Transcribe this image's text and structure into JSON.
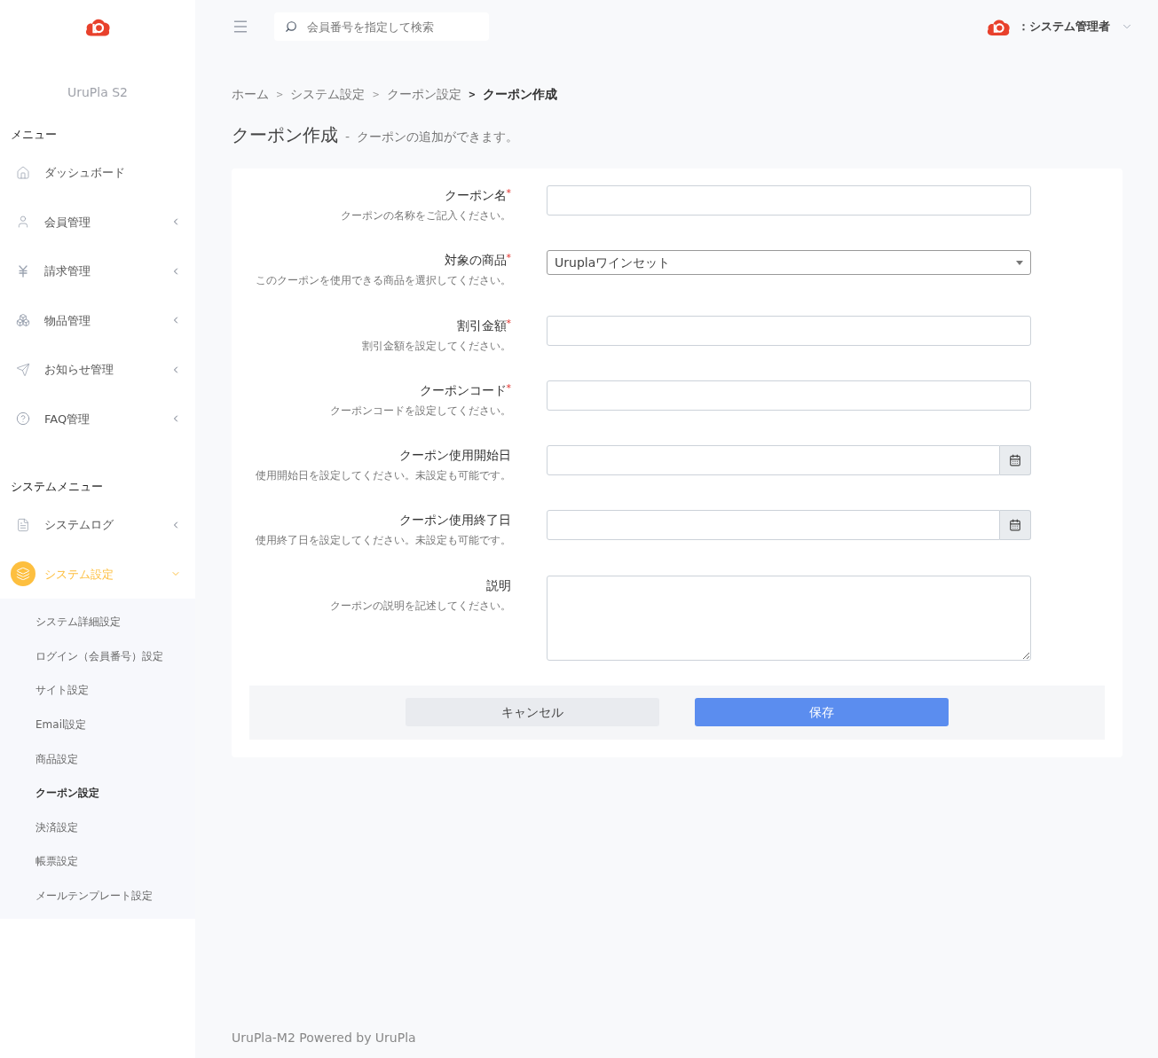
{
  "sidebar": {
    "brand": "UruPla S2",
    "sections": [
      {
        "title": "メニュー",
        "items": [
          {
            "label": "ダッシュボード",
            "expandable": false,
            "selected": false
          },
          {
            "label": "会員管理",
            "expandable": true,
            "selected": false,
            "expanded": false
          },
          {
            "label": "請求管理",
            "expandable": true,
            "selected": false,
            "expanded": false
          },
          {
            "label": "物品管理",
            "expandable": true,
            "selected": false,
            "expanded": false
          },
          {
            "label": "お知らせ管理",
            "expandable": true,
            "selected": false,
            "expanded": false
          },
          {
            "label": "FAQ管理",
            "expandable": true,
            "selected": false,
            "expanded": false
          }
        ]
      },
      {
        "title": "システムメニュー",
        "items": [
          {
            "label": "システムログ",
            "expandable": true,
            "selected": false,
            "expanded": false
          },
          {
            "label": "システム設定",
            "expandable": true,
            "selected": true,
            "expanded": true,
            "children": [
              {
                "label": "システム詳細設定",
                "selected": false
              },
              {
                "label": "ログイン（会員番号）設定",
                "selected": false
              },
              {
                "label": "サイト設定",
                "selected": false
              },
              {
                "label": "Email設定",
                "selected": false
              },
              {
                "label": "商品設定",
                "selected": false
              },
              {
                "label": "クーポン設定",
                "selected": true
              },
              {
                "label": "決済設定",
                "selected": false
              },
              {
                "label": "帳票設定",
                "selected": false
              },
              {
                "label": "メールテンプレート設定",
                "selected": false
              }
            ]
          }
        ]
      }
    ]
  },
  "header": {
    "search": {
      "placeholder": "会員番号を指定して検索"
    },
    "user": "：システム管理者"
  },
  "breadcrumb": [
    {
      "label": "ホーム",
      "current": false
    },
    {
      "label": "システム設定",
      "current": false
    },
    {
      "label": "クーポン設定",
      "current": false
    },
    {
      "label": "クーポン作成",
      "current": true
    }
  ],
  "breadcrumb_separator": ">",
  "page": {
    "title": "クーポン作成",
    "separator": "-",
    "subtitle": "クーポンの追加ができます。"
  },
  "form": {
    "fields": [
      {
        "kind": "text",
        "label": "クーポン名",
        "required": true,
        "help": "クーポンの名称をご記入ください。"
      },
      {
        "kind": "select",
        "label": "対象の商品",
        "required": true,
        "help": "このクーポンを使用できる商品を選択してください。",
        "value": "Uruplaワインセット"
      },
      {
        "kind": "text",
        "label": "割引金額",
        "required": true,
        "help": "割引金額を設定してください。"
      },
      {
        "kind": "text",
        "label": "クーポンコード",
        "required": true,
        "help": "クーポンコードを設定してください。"
      },
      {
        "kind": "date",
        "label": "クーポン使用開始日",
        "required": false,
        "help": "使用開始日を設定してください。未設定も可能です。"
      },
      {
        "kind": "date",
        "label": "クーポン使用終了日",
        "required": false,
        "help": "使用終了日を設定してください。未設定も可能です。"
      },
      {
        "kind": "textarea",
        "label": "説明",
        "required": false,
        "help": "クーポンの説明を記述してください。"
      }
    ],
    "required_mark": "*",
    "buttons": [
      {
        "kind": "secondary",
        "label": "キャンセル"
      },
      {
        "kind": "primary",
        "label": "保存"
      }
    ]
  },
  "footer": "UruPla-M2 Powered by UruPla"
}
